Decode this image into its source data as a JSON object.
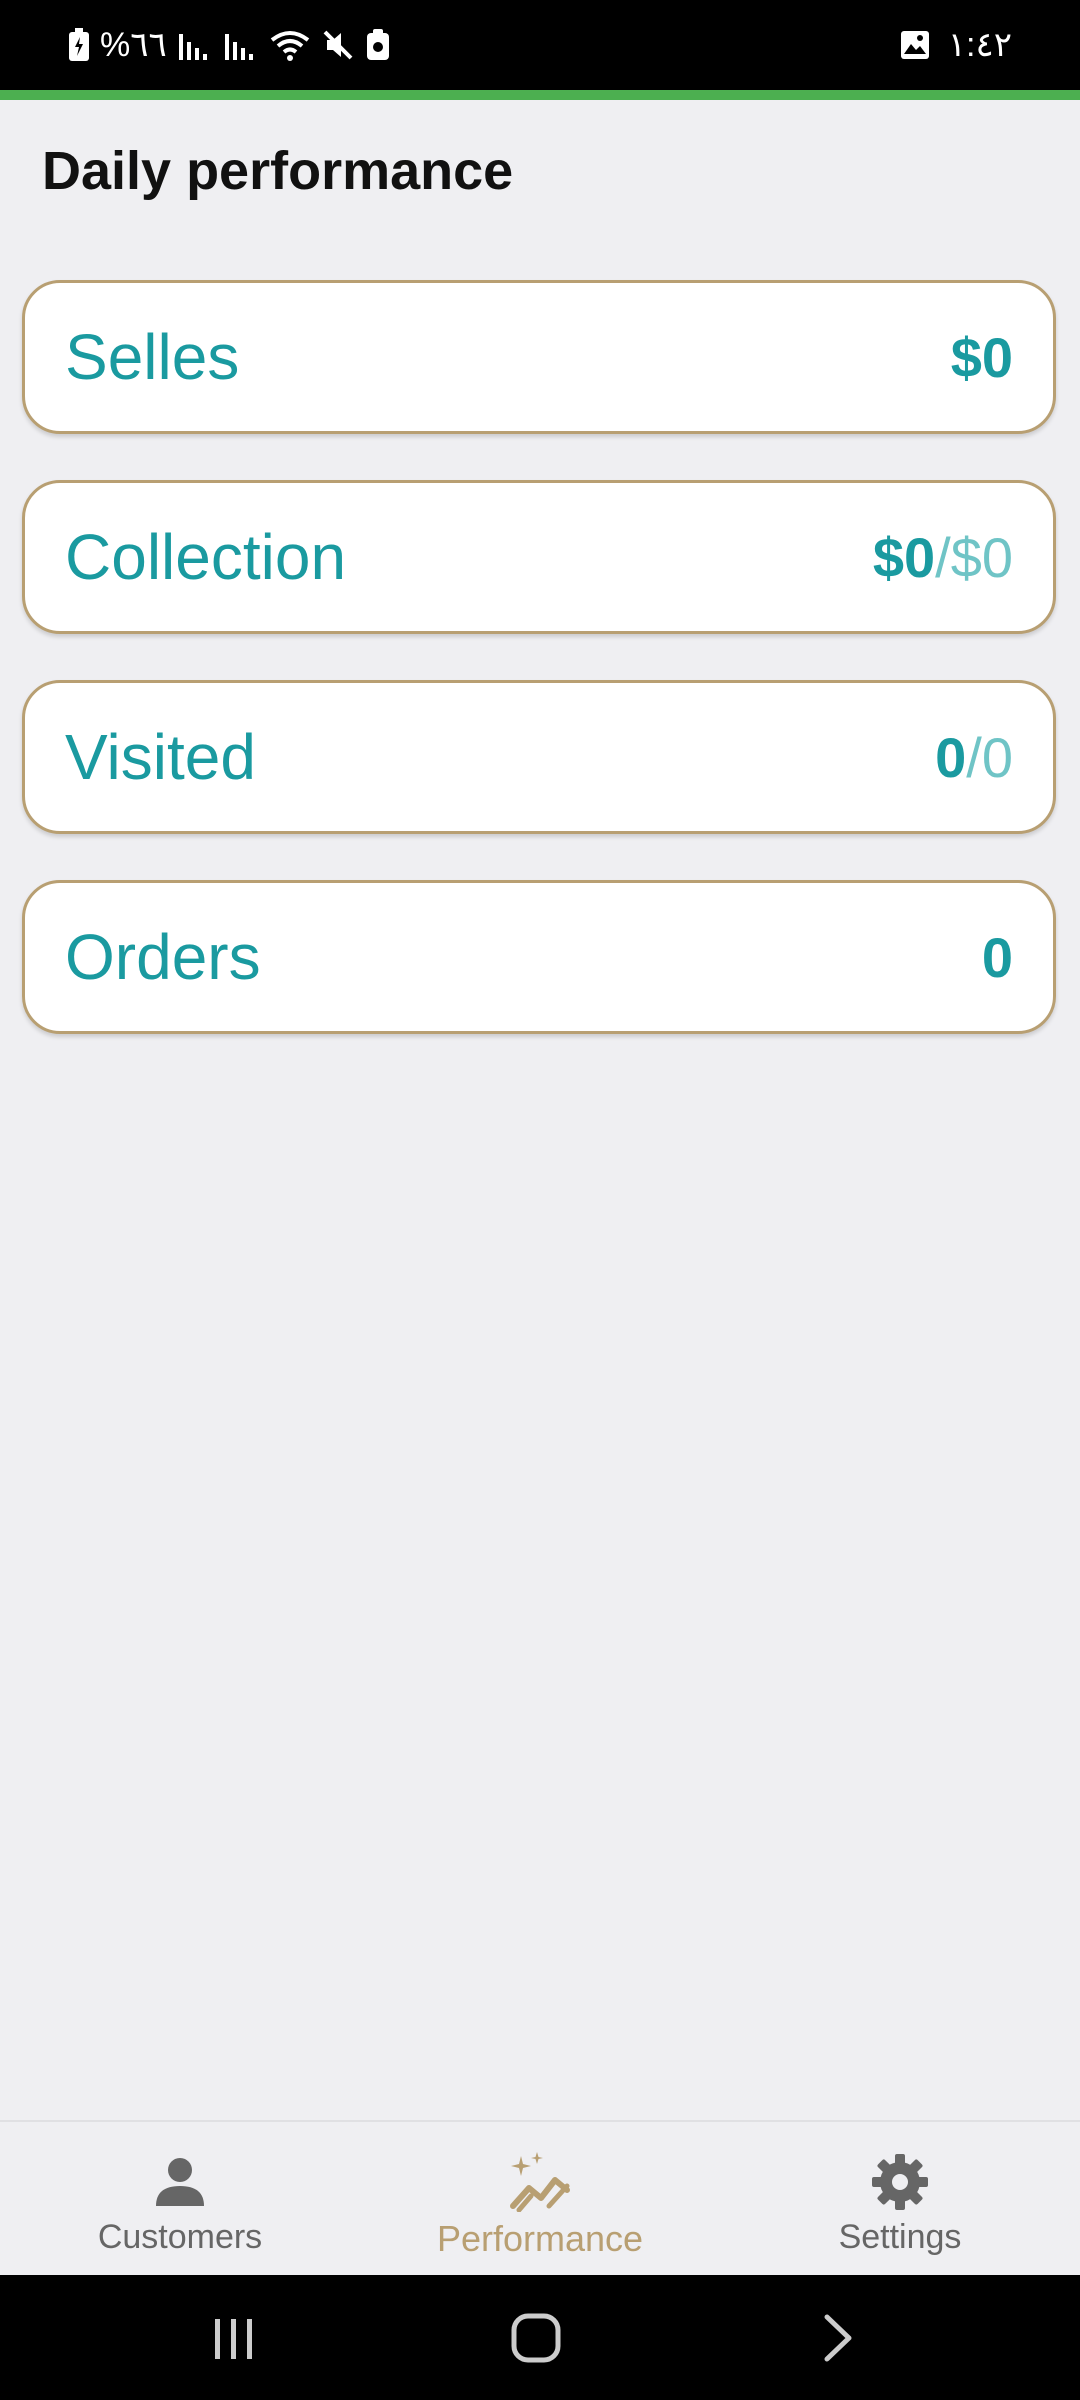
{
  "status_bar": {
    "battery_text": "%٦٦",
    "time": "١:٤٢"
  },
  "page": {
    "title": "Daily performance"
  },
  "cards": [
    {
      "label": "Selles",
      "value": "$0",
      "separator": "",
      "target": ""
    },
    {
      "label": "Collection",
      "value": "$0",
      "separator": "/",
      "target": "$0"
    },
    {
      "label": "Visited",
      "value": "0",
      "separator": "/",
      "target": "0"
    },
    {
      "label": "Orders",
      "value": "0",
      "separator": "",
      "target": ""
    }
  ],
  "bottom_nav": {
    "items": [
      {
        "label": "Customers",
        "icon": "person-icon",
        "active": false
      },
      {
        "label": "Performance",
        "icon": "sparkle-chart-icon",
        "active": true
      },
      {
        "label": "Settings",
        "icon": "gear-icon",
        "active": false
      }
    ]
  },
  "colors": {
    "accent": "#4caf50",
    "teal": "#1a9aa0",
    "teal_light": "#6fc4c6",
    "gold": "#b89f72"
  }
}
